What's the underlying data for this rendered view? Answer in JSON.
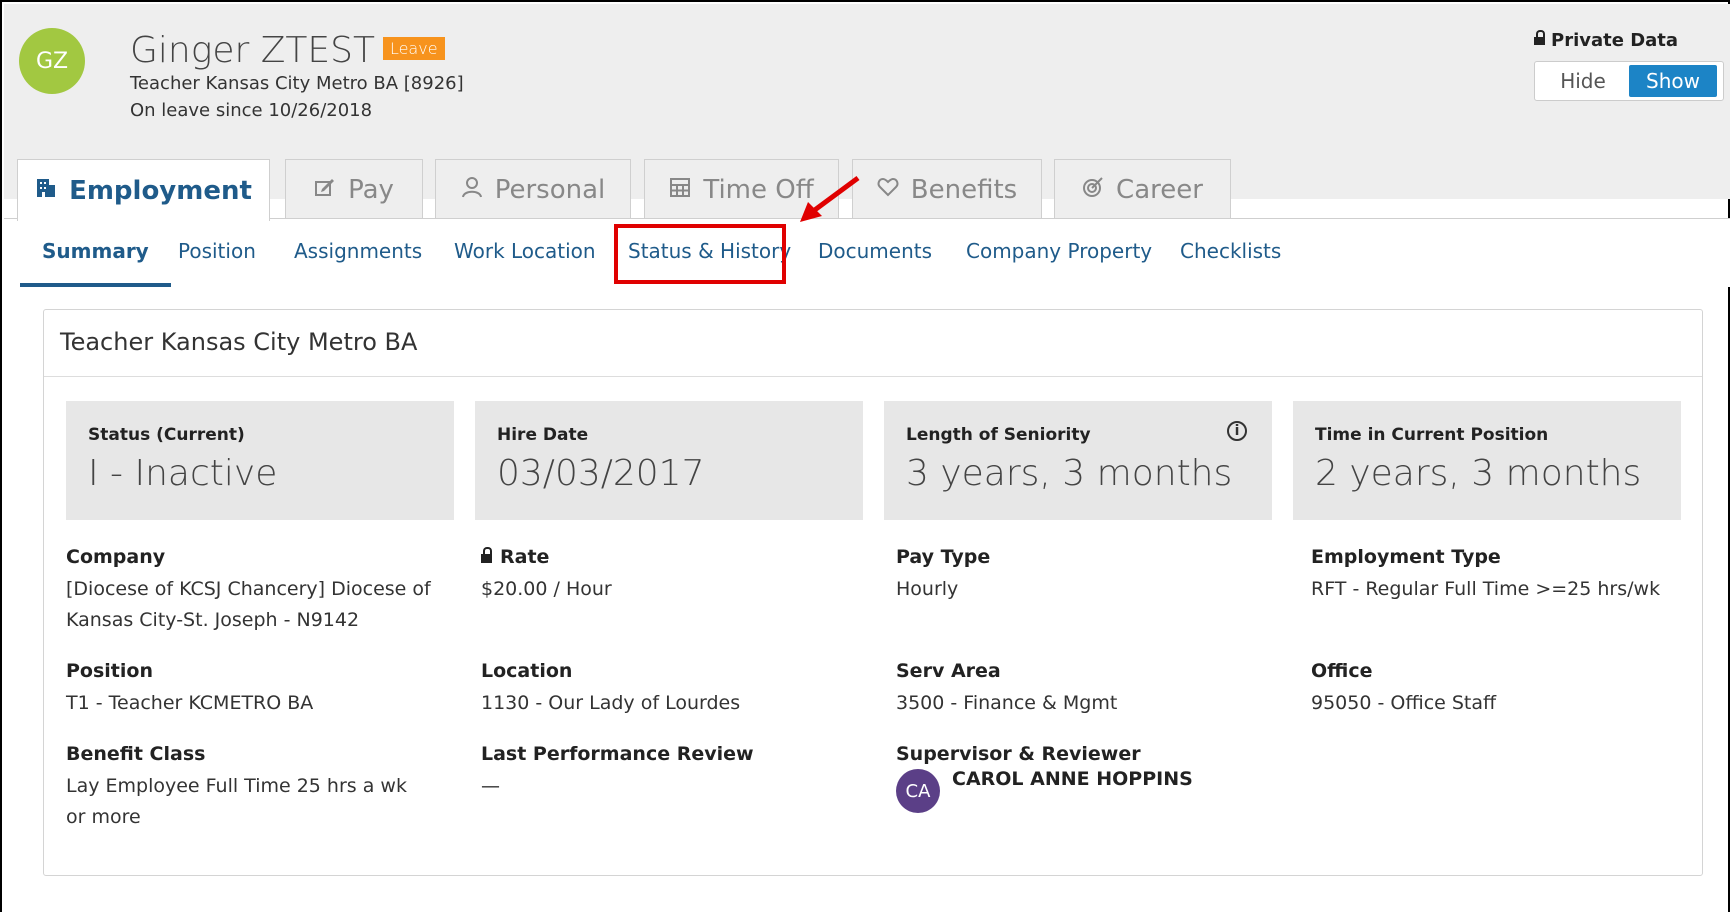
{
  "header": {
    "avatar_initials": "GZ",
    "name": "Ginger ZTEST",
    "status_badge": "Leave",
    "job_line": "Teacher Kansas City Metro BA [8926]",
    "leave_line": "On leave since 10/26/2018"
  },
  "private_data": {
    "label": "Private Data",
    "hide_label": "Hide",
    "show_label": "Show",
    "selected": "Show"
  },
  "tabs": [
    {
      "label": "Employment",
      "icon": "building-icon",
      "active": true
    },
    {
      "label": "Pay",
      "icon": "edit-icon"
    },
    {
      "label": "Personal",
      "icon": "person-icon"
    },
    {
      "label": "Time Off",
      "icon": "calendar-grid-icon"
    },
    {
      "label": "Benefits",
      "icon": "heart-icon"
    },
    {
      "label": "Career",
      "icon": "target-icon"
    }
  ],
  "subtabs": [
    {
      "label": "Summary",
      "active": true
    },
    {
      "label": "Position"
    },
    {
      "label": "Assignments"
    },
    {
      "label": "Work Location"
    },
    {
      "label": "Status & History",
      "highlighted": true
    },
    {
      "label": "Documents"
    },
    {
      "label": "Company Property"
    },
    {
      "label": "Checklists"
    }
  ],
  "card": {
    "title": "Teacher Kansas City Metro BA",
    "stats": [
      {
        "label": "Status (Current)",
        "value": "I - Inactive"
      },
      {
        "label": "Hire Date",
        "value": "03/03/2017"
      },
      {
        "label": "Length of Seniority",
        "value": "3 years, 3 months",
        "info_icon": "info-icon"
      },
      {
        "label": "Time in Current Position",
        "value": "2 years, 3 months"
      }
    ],
    "fields": {
      "company": {
        "label": "Company",
        "value": "[Diocese of KCSJ Chancery] Diocese of Kansas City-St. Joseph - N9142"
      },
      "rate": {
        "label": "Rate",
        "value": "$20.00 / Hour"
      },
      "pay_type": {
        "label": "Pay Type",
        "value": "Hourly"
      },
      "employment_type": {
        "label": "Employment Type",
        "value": "RFT - Regular Full Time >=25 hrs/wk"
      },
      "position": {
        "label": "Position",
        "value": "T1 - Teacher KCMETRO BA"
      },
      "location": {
        "label": "Location",
        "value": "1130 - Our Lady of Lourdes"
      },
      "serv_area": {
        "label": "Serv Area",
        "value": "3500 - Finance & Mgmt"
      },
      "office": {
        "label": "Office",
        "value": "95050 - Office Staff"
      },
      "benefit_class": {
        "label": "Benefit Class",
        "value": "Lay Employee Full Time 25 hrs a wk or more"
      },
      "last_review": {
        "label": "Last Performance Review",
        "value": "—"
      },
      "supervisor": {
        "label": "Supervisor & Reviewer",
        "initials": "CA",
        "name": "CAROL ANNE HOPPINS"
      }
    }
  },
  "colors": {
    "accent": "#1f5b8a",
    "toggle_active": "#1c84c6",
    "leave_badge": "#f7931d",
    "avatar": "#a2c841",
    "supervisor_avatar": "#5b3f87",
    "annotation": "#e00000"
  }
}
